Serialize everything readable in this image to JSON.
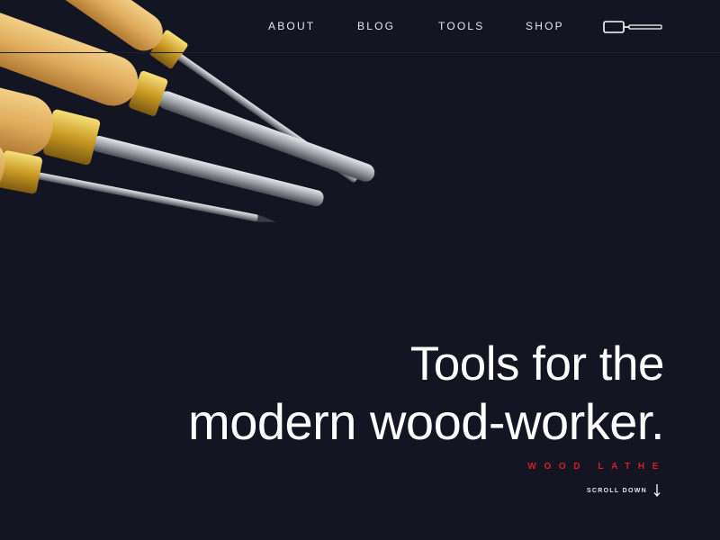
{
  "nav": {
    "items": [
      {
        "label": "ABOUT"
      },
      {
        "label": "BLOG"
      },
      {
        "label": "TOOLS"
      },
      {
        "label": "SHOP"
      }
    ],
    "logo_icon": "chisel-logo-icon"
  },
  "hero": {
    "headline_line1": "Tools for the",
    "headline_line2": "modern wood-worker.",
    "subtitle": "WOOD LATHE",
    "scroll_label": "SCROLL DOWN",
    "scroll_icon": "arrow-down-icon",
    "image_subject": "wood-lathe-chisels-photo"
  },
  "colors": {
    "background": "#141522",
    "text": "#ffffff",
    "accent": "#d0202b"
  }
}
